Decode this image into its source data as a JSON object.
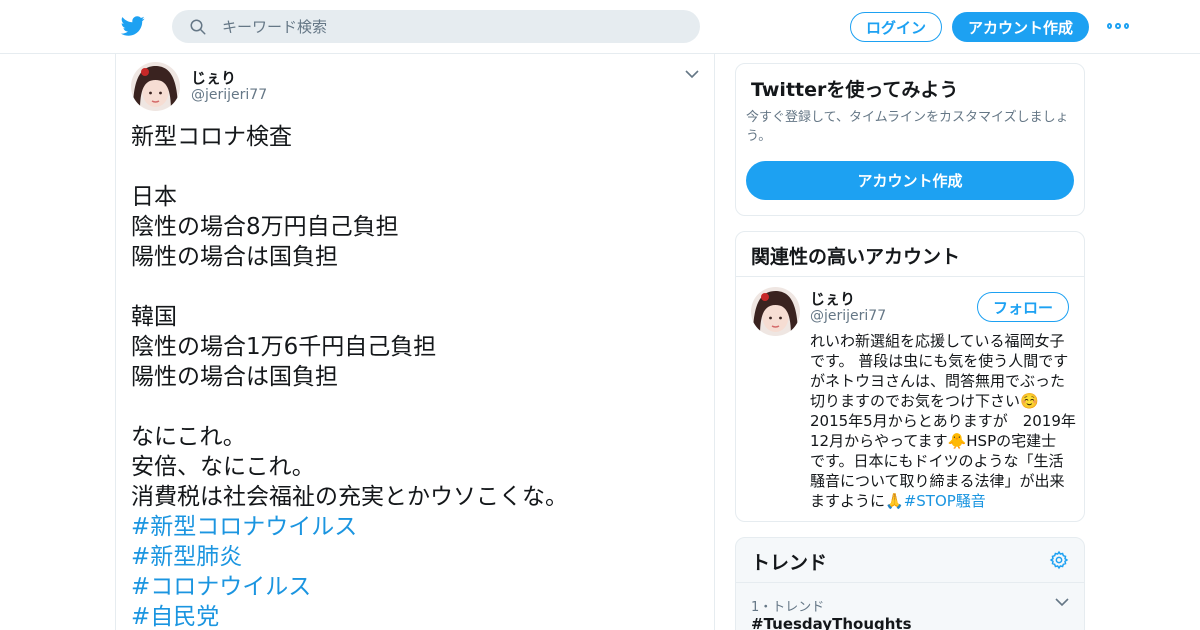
{
  "header": {
    "search_placeholder": "キーワード検索",
    "login_label": "ログイン",
    "signup_label": "アカウント作成",
    "icons": [
      "twitter-logo-icon",
      "search-icon",
      "more-icon"
    ]
  },
  "tweet": {
    "author_name": "じぇり",
    "author_handle": "@jerijeri77",
    "lines": [
      {
        "text": "新型コロナ検査",
        "hashtag": false
      },
      {
        "text": "",
        "hashtag": false
      },
      {
        "text": "日本",
        "hashtag": false
      },
      {
        "text": "陰性の場合8万円自己負担",
        "hashtag": false
      },
      {
        "text": "陽性の場合は国負担",
        "hashtag": false
      },
      {
        "text": "",
        "hashtag": false
      },
      {
        "text": "韓国",
        "hashtag": false
      },
      {
        "text": "陰性の場合1万6千円自己負担",
        "hashtag": false
      },
      {
        "text": "陽性の場合は国負担",
        "hashtag": false
      },
      {
        "text": "",
        "hashtag": false
      },
      {
        "text": "なにこれ。",
        "hashtag": false
      },
      {
        "text": "安倍、なにこれ。",
        "hashtag": false
      },
      {
        "text": "消費税は社会福祉の充実とかウソこくな。",
        "hashtag": false
      },
      {
        "text": "#新型コロナウイルス",
        "hashtag": true
      },
      {
        "text": "#新型肺炎",
        "hashtag": true
      },
      {
        "text": "#コロナウイルス",
        "hashtag": true
      },
      {
        "text": "#自民党",
        "hashtag": true
      }
    ]
  },
  "signup_card": {
    "title": "Twitterを使ってみよう",
    "description": "今すぐ登録して、タイムラインをカスタマイズしましょう。",
    "cta_label": "アカウント作成"
  },
  "related_card": {
    "title": "関連性の高いアカウント",
    "account": {
      "name": "じぇり",
      "handle": "@jerijeri77",
      "follow_label": "フォロー",
      "bio_lines": [
        "れいわ新選組を応援している福岡女子",
        "です。 普段は虫にも気を使う人間です",
        "がネトウヨさんは、問答無用でぶった",
        "切りますのでお気をつけ下さい☺️",
        "2015年5月からとありますが　2019年",
        "12月からやってます🐥HSPの宅建士",
        "です。日本にもドイツのような「生活",
        "騒音について取り締まる法律」が出来"
      ],
      "bio_last_prefix": "ますように🙏",
      "bio_last_link": "#STOP騒音"
    }
  },
  "trends_card": {
    "title": "トレンド",
    "items": [
      {
        "rank_label": "1・トレンド",
        "name": "#TuesdayThoughts"
      }
    ]
  },
  "colors": {
    "brand_blue": "#1da1f2",
    "link_blue": "#1b95e0",
    "text_primary": "#14171a",
    "text_secondary": "#657786",
    "border": "#e6ecf0"
  }
}
